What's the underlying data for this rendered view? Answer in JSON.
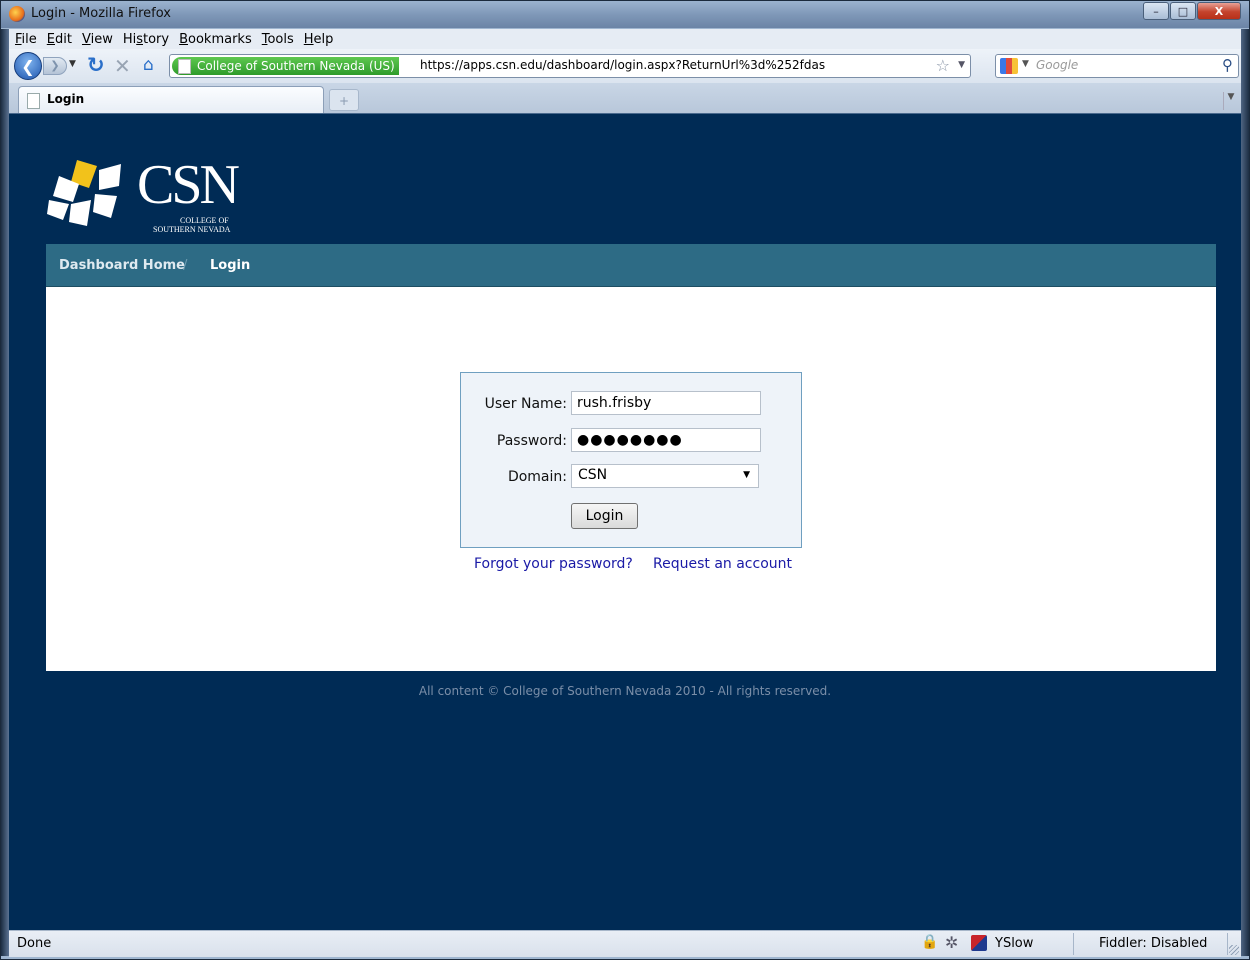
{
  "window": {
    "title": "Login - Mozilla Firefox",
    "minimize": "–",
    "maximize": "□",
    "close": "X"
  },
  "menu": [
    {
      "label": "File",
      "accel": "F",
      "rest": "ile"
    },
    {
      "label": "Edit",
      "accel": "E",
      "rest": "dit"
    },
    {
      "label": "View",
      "accel": "V",
      "rest": "iew"
    },
    {
      "label": "History",
      "pre": "Hi",
      "accel": "s",
      "rest": "tory"
    },
    {
      "label": "Bookmarks",
      "accel": "B",
      "rest": "ookmarks"
    },
    {
      "label": "Tools",
      "accel": "T",
      "rest": "ools"
    },
    {
      "label": "Help",
      "accel": "H",
      "rest": "elp"
    }
  ],
  "nav": {
    "identity": "College of Southern Nevada (US)",
    "url": "https://apps.csn.edu/dashboard/login.aspx?ReturnUrl%3d%252fdas",
    "search_placeholder": "Google",
    "back_icon": "back-arrow-icon",
    "reload_icon": "reload-icon",
    "stop_icon": "stop-icon",
    "home_icon": "home-icon"
  },
  "tabs": [
    {
      "label": "Login"
    }
  ],
  "page": {
    "logo": {
      "text": "CSN",
      "sub1": "COLLEGE OF",
      "sub2": "SOUTHERN NEVADA"
    },
    "breadcrumb": {
      "home": "Dashboard Home",
      "separator": "/",
      "current": "Login"
    },
    "form": {
      "username_label": "User Name:",
      "username_value": "rush.frisby",
      "password_label": "Password:",
      "password_value": "●●●●●●●●",
      "domain_label": "Domain:",
      "domain_value": "CSN",
      "login_button": "Login"
    },
    "links": {
      "forgot": "Forgot your password?",
      "request": "Request an account"
    },
    "footer": "All content © College of Southern Nevada 2010 - All rights reserved."
  },
  "status": {
    "text": "Done",
    "yslow": "YSlow",
    "fiddler": "Fiddler: Disabled"
  }
}
